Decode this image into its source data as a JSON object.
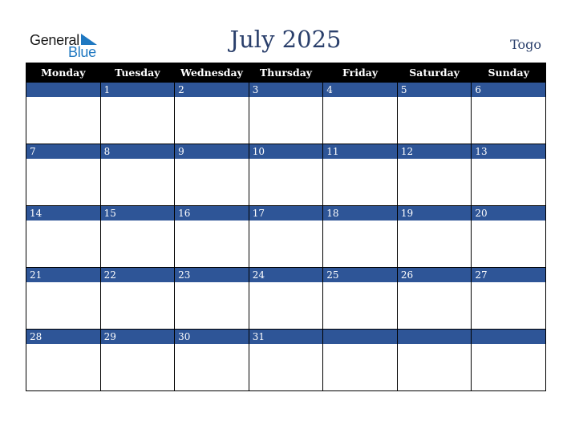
{
  "logo": {
    "word1": "General",
    "word2": "Blue"
  },
  "title": "July 2025",
  "country": "Togo",
  "colors": {
    "header_bg": "#000000",
    "date_band": "#2e5597",
    "title": "#2a3f6b",
    "logo_blue": "#1f78c1"
  },
  "weekdays": [
    "Monday",
    "Tuesday",
    "Wednesday",
    "Thursday",
    "Friday",
    "Saturday",
    "Sunday"
  ],
  "weeks": [
    [
      "",
      "1",
      "2",
      "3",
      "4",
      "5",
      "6"
    ],
    [
      "7",
      "8",
      "9",
      "10",
      "11",
      "12",
      "13"
    ],
    [
      "14",
      "15",
      "16",
      "17",
      "18",
      "19",
      "20"
    ],
    [
      "21",
      "22",
      "23",
      "24",
      "25",
      "26",
      "27"
    ],
    [
      "28",
      "29",
      "30",
      "31",
      "",
      "",
      ""
    ]
  ]
}
